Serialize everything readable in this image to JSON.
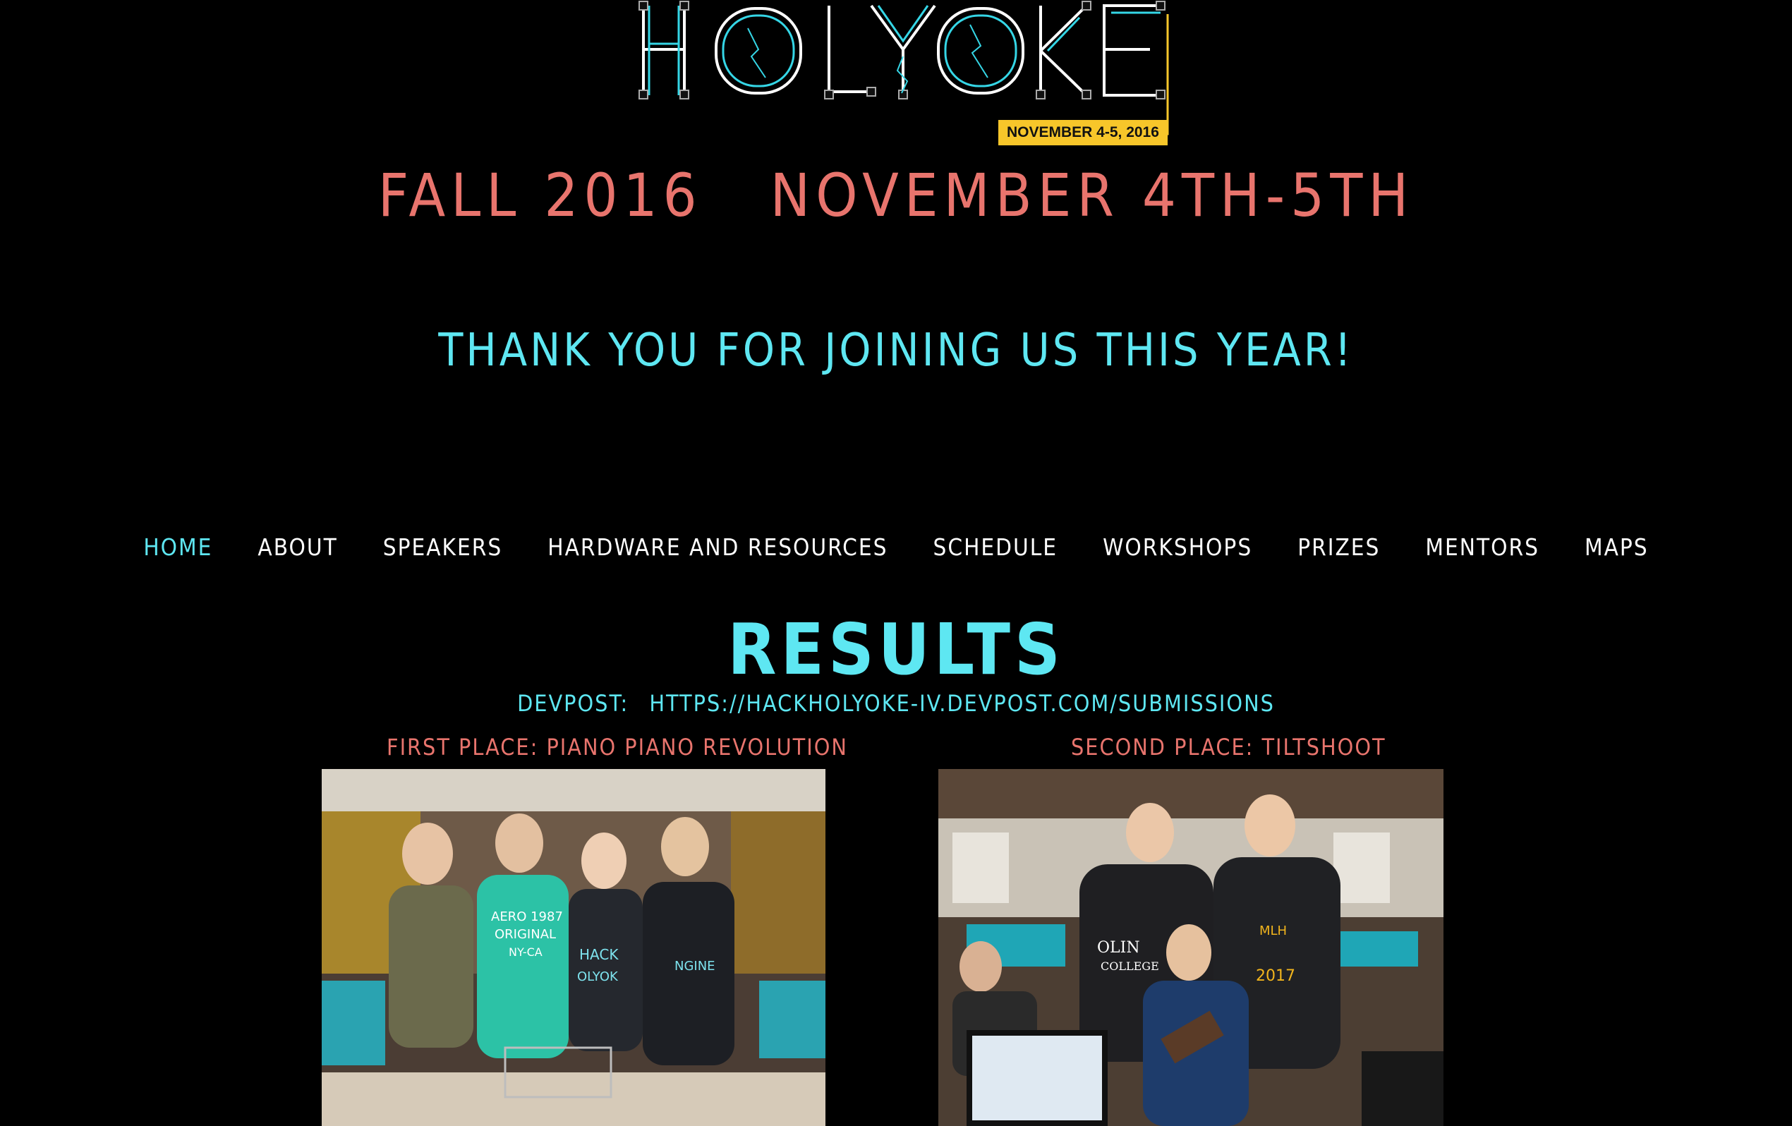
{
  "logo": {
    "wordmark": "HOLYOKE",
    "date_badge": "NOVEMBER 4-5, 2016",
    "colors": {
      "outline": "#ffffff",
      "accent": "#35d6e6",
      "badge": "#f7c62a"
    }
  },
  "header": {
    "season": "FALL 2016",
    "dates": "NOVEMBER 4TH-5TH",
    "thanks": "THANK YOU FOR JOINING US THIS YEAR!"
  },
  "nav": {
    "items": [
      {
        "label": "HOME",
        "active": true
      },
      {
        "label": "ABOUT",
        "active": false
      },
      {
        "label": "SPEAKERS",
        "active": false
      },
      {
        "label": "HARDWARE AND RESOURCES",
        "active": false
      },
      {
        "label": "SCHEDULE",
        "active": false
      },
      {
        "label": "WORKSHOPS",
        "active": false
      },
      {
        "label": "PRIZES",
        "active": false
      },
      {
        "label": "MENTORS",
        "active": false
      },
      {
        "label": "MAPS",
        "active": false
      }
    ]
  },
  "results": {
    "title": "RESULTS",
    "devpost_label": "DEVPOST:",
    "devpost_link": "HTTPS://HACKHOLYOKE-IV.DEVPOST.COM/SUBMISSIONS",
    "first_place": "FIRST PLACE: PIANO PIANO REVOLUTION",
    "second_place": "SECOND PLACE: TILTSHOOT",
    "photo1_text": [
      "AERO 1987",
      "ORIGINAL",
      "NY-CA",
      "HACK",
      "OLYOK",
      "NGINE"
    ],
    "photo2_text": [
      "OLIN",
      "COLLEGE",
      "MLH",
      "2017"
    ]
  },
  "colors": {
    "coral": "#e8746d",
    "cyan": "#5ee7f2",
    "background": "#000000"
  }
}
